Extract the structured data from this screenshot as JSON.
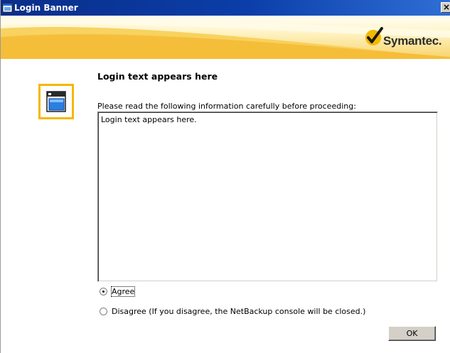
{
  "window": {
    "title": "Login Banner",
    "close_label": "×"
  },
  "brand": {
    "logo_text": "Symantec.",
    "brand_color": "#f5b700"
  },
  "content": {
    "heading": "Login text appears here",
    "instruction": "Please read the following information carefully before proceeding:",
    "banner_text": "Login text appears here."
  },
  "options": {
    "agree": {
      "label": "Agree",
      "checked": true
    },
    "disagree": {
      "label": "Disagree (If you disagree, the NetBackup console will be closed.)",
      "checked": false
    }
  },
  "actions": {
    "ok_label": "OK"
  }
}
